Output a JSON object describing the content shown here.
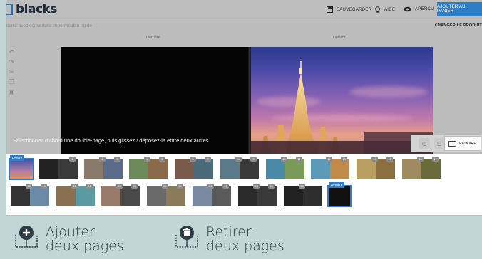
{
  "brand": {
    "name": "blacks"
  },
  "toolbar": {
    "save_label": "SAUVEGARDER",
    "help_label": "AIDE",
    "preview_label": "APERÇU",
    "add_to_cart_label": "AJOUTER AU PANIER"
  },
  "product": {
    "description": "carré avec couverture imperméable rigide",
    "change_label": "CHANGER LE PRODUIT"
  },
  "editor": {
    "left_page_label": "Derrière",
    "right_page_label": "Devant",
    "hint": "Sélectionnez d'abord une double-page, puis glissez / déposez-la entre deux autres",
    "reduce_label": "RÉDUIRE"
  },
  "icons": {
    "save": "save-icon",
    "help": "lightbulb-icon",
    "preview": "eye-icon",
    "undo": "undo-icon",
    "redo": "redo-icon",
    "cut": "scissors-icon",
    "copy": "copy-icon",
    "paste": "paste-icon",
    "add_pages": "add-pages-icon",
    "remove_pages": "remove-pages-icon",
    "reduce": "monitor-icon"
  },
  "colors": {
    "accent": "#2c7fc7",
    "page_bg": "#c3d6d6"
  },
  "thumbnails": {
    "cover_label": "Devant",
    "back_label": "Derrière",
    "spreads": [
      {
        "left": "",
        "right": "1"
      },
      {
        "left": "2",
        "right": "3"
      },
      {
        "left": "4",
        "right": "5"
      },
      {
        "left": "6",
        "right": "7"
      },
      {
        "left": "8",
        "right": "9"
      },
      {
        "left": "10",
        "right": "11"
      },
      {
        "left": "12",
        "right": "13"
      },
      {
        "left": "14",
        "right": "15"
      },
      {
        "left": "16",
        "right": "17"
      },
      {
        "left": "18",
        "right": "19"
      },
      {
        "left": "20",
        "right": "21"
      },
      {
        "left": "22",
        "right": "23"
      },
      {
        "left": "24",
        "right": "25"
      },
      {
        "left": "26",
        "right": "27"
      },
      {
        "left": "28",
        "right": "29"
      },
      {
        "left": "30",
        "right": ""
      }
    ]
  },
  "actions": {
    "add_line1": "Ajouter",
    "add_line2": "deux pages",
    "remove_line1": "Retirer",
    "remove_line2": "deux pages"
  }
}
